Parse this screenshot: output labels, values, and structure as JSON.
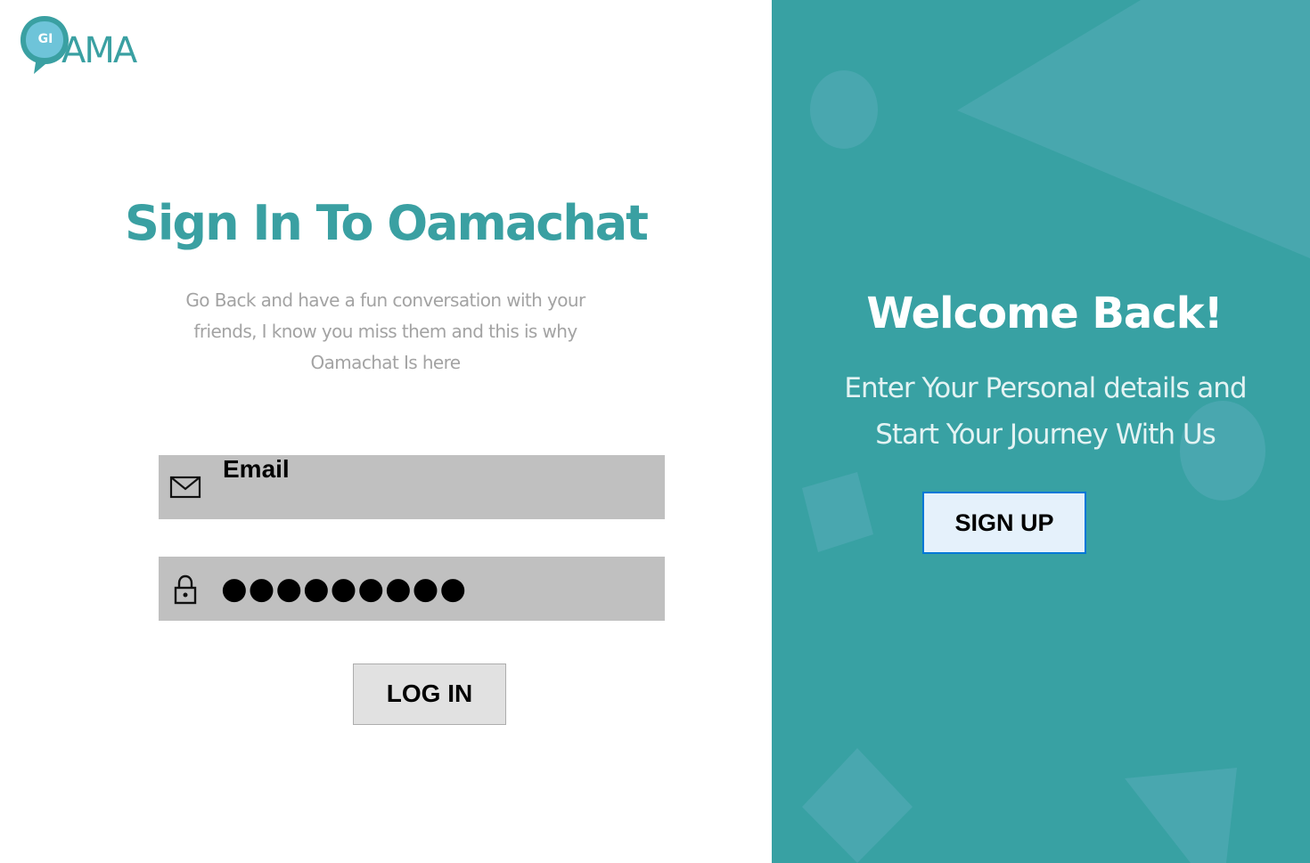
{
  "logo": {
    "badge_text": "GI",
    "wordmark": "AMA"
  },
  "left_panel": {
    "title": "Sign In To Oamachat",
    "subtitle": "Go Back and have a fun conversation with your friends, I know you miss them  and this is why Oamachat Is here",
    "email_field": {
      "icon": "mail-icon",
      "placeholder": "Email"
    },
    "password_field": {
      "icon": "lock-icon",
      "value": "●●●●●●●●●"
    },
    "login_button": "LOG IN"
  },
  "right_panel": {
    "heading": "Welcome Back!",
    "subtitle": "Enter Your Personal details and Start Your Journey With Us",
    "signup_button": "SIGN UP"
  },
  "colors": {
    "brand_teal": "#3aa0a2",
    "panel_teal": "#38a1a3",
    "input_bg": "#c0c0c0",
    "subtitle_gray": "#a3a3a3"
  }
}
